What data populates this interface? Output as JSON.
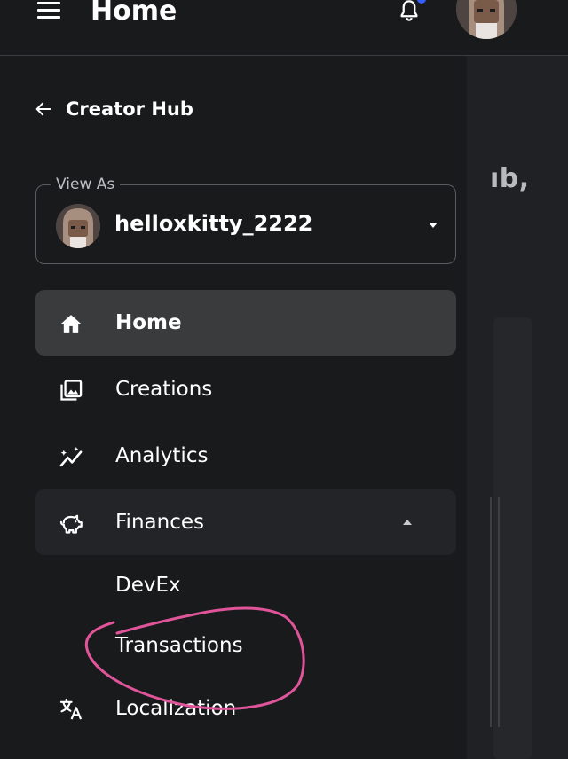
{
  "header": {
    "title": "Home",
    "icons": [
      "hamburger-menu-icon",
      "bell-icon",
      "avatar"
    ],
    "notification_dot_color": "#335fff"
  },
  "drawer": {
    "back_label": "Creator Hub",
    "view_as": {
      "label": "View As",
      "username": "helloxkitty_2222"
    },
    "nav": [
      {
        "label": "Home",
        "icon": "home-icon",
        "state": "active"
      },
      {
        "label": "Creations",
        "icon": "image-gallery-icon"
      },
      {
        "label": "Analytics",
        "icon": "sparkle-line-chart-icon"
      },
      {
        "label": "Finances",
        "icon": "piggy-bank-icon",
        "state": "expanded",
        "children": [
          "DevEx",
          "Transactions"
        ]
      },
      {
        "label": "Localization",
        "icon": "translate-icon"
      }
    ]
  },
  "background": {
    "partial_heading": "ıb,"
  },
  "annotation": {
    "type": "hand-drawn circle",
    "target": "Transactions",
    "color": "#e0559a"
  }
}
